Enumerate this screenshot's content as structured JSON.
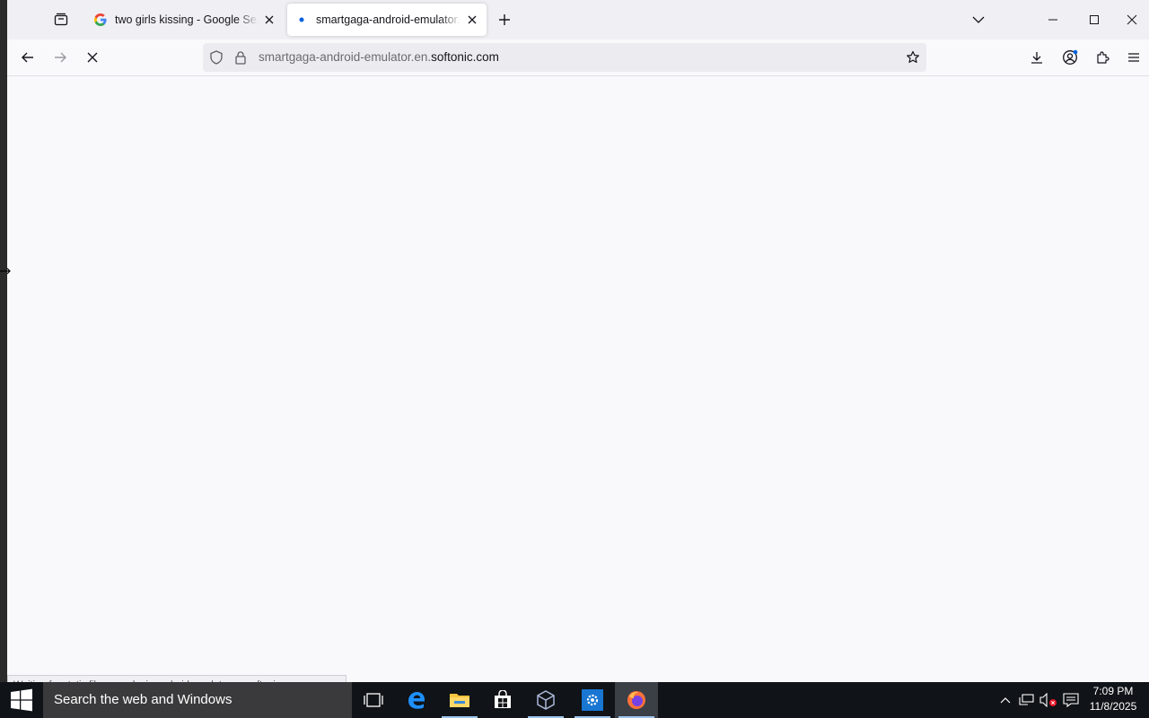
{
  "browser": {
    "tabs": [
      {
        "title": "two girls kissing - Google Search",
        "favicon": "google-g-icon",
        "active": false
      },
      {
        "title": "smartgaga-android-emulator.en.softonic.com",
        "favicon": "loading-dot-icon",
        "active": true
      }
    ],
    "url": {
      "subdomain": "smartgaga-android-emulator.en.",
      "domain": "softonic.com"
    },
    "status_text": "Waiting for static.files.wpgplugin.android.emulator.en.softonic.com..."
  },
  "taskbar": {
    "search_placeholder": "Search the web and Windows",
    "time": "7:09 PM",
    "date": "11/8/2025"
  },
  "colors": {
    "accent": "#0060df",
    "taskbar": "#101317",
    "searchbox": "#3a3a3c"
  }
}
